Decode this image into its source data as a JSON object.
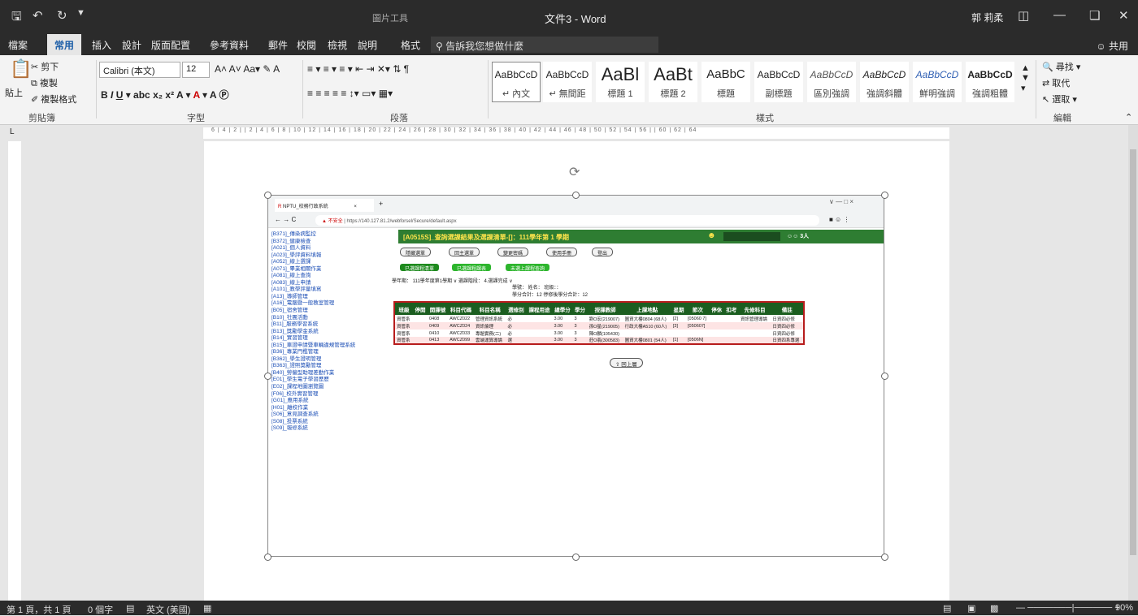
{
  "titlebar": {
    "save_icon": "save-icon",
    "undo_icon": "undo-icon",
    "redo_icon": "redo-icon",
    "context_tab": "圖片工具",
    "doc_title": "文件3 - Word",
    "user": "郭 莉柔"
  },
  "tabs": [
    "檔案",
    "常用",
    "插入",
    "設計",
    "版面配置",
    "參考資料",
    "郵件",
    "校閱",
    "檢視",
    "說明",
    "格式"
  ],
  "tell_me": "告訴我您想做什麼",
  "share": "共用",
  "clipboard": {
    "paste": "貼上",
    "cut": "剪下",
    "copy": "複製",
    "format_painter": "複製格式",
    "label": "剪貼簿"
  },
  "font": {
    "name": "Calibri (本文)",
    "size": "12",
    "label": "字型"
  },
  "paragraph": {
    "label": "段落"
  },
  "styles": {
    "label": "樣式",
    "items": [
      {
        "sample": "AaBbCcD",
        "name": "↵ 內文"
      },
      {
        "sample": "AaBbCcD",
        "name": "↵ 無間距"
      },
      {
        "sample": "AaBl",
        "name": "標題 1"
      },
      {
        "sample": "AaBt",
        "name": "標題 2"
      },
      {
        "sample": "AaBbC",
        "name": "標題"
      },
      {
        "sample": "AaBbCcD",
        "name": "副標題"
      },
      {
        "sample": "AaBbCcD",
        "name": "區別強調"
      },
      {
        "sample": "AaBbCcD",
        "name": "強調斜體"
      },
      {
        "sample": "AaBbCcD",
        "name": "鮮明強調"
      },
      {
        "sample": "AaBbCcD",
        "name": "強調粗體"
      }
    ]
  },
  "editing": {
    "find": "尋找",
    "replace": "取代",
    "select": "選取",
    "label": "編輯"
  },
  "ruler_text": "6 | 4 | 2 | | 2 | 4 | 6 | 8 | 10 | 12 | 14 | 16 | 18 | 20 | 22 | 24 | 26 | 28 | 30 | 32 | 34 | 36 | 38 | 40 | 42 | 44 | 46 | 48 | 50 | 52 | 54 | 56 | | 60 | 62 | 64",
  "status": {
    "page": "第 1 頁，共 1 頁",
    "words": "0 個字",
    "lang": "英文 (美國)",
    "zoom": "90%"
  },
  "screenshot": {
    "tab_title": "NPTU_校務行政系統",
    "url_warning": "不安全",
    "url": "https://140.127.81.2/webforsel/Secure/default.aspx",
    "nav": [
      "[B371]_傳染病監控",
      "[B372]_健康檢查",
      "[A021]_個人資料",
      "[A023]_學評資料填報",
      "[A052]_線上選課",
      "[A071]_畢業相關作業",
      "[A081]_線上查詢",
      "[A083]_線上申請",
      "[A101]_教學評量填寫",
      "[A13]_導師管理",
      "[A16]_電腦暨一般教室管理",
      "[B05]_宿舍管理",
      "[B10]_社團活動",
      "[B11]_服務學習系統",
      "[B13]_獎勵學金系統",
      "[B14]_實習管理",
      "[B15]_車證申請暨車輛違規管理系統",
      "[B36]_專業門檻管理",
      "[B362]_學生證明管理",
      "[B363]_證照獎勵管理",
      "[B40]_勞僱型助理差勤作業",
      "[E01]_學生電子學習歷歷",
      "[E02]_課程地圖瀏覽圖",
      "[F06]_校外實習管理",
      "[G01]_應用系統",
      "[H01]_離校作業",
      "[S06]_意見調查系統",
      "[S08]_投票系統",
      "[S09]_報修系統"
    ],
    "header": "[A0515S]_查詢選課結果及選課清單-[]：111學年第 1 學期",
    "header_count": "3人",
    "buttons": [
      "隱藏選單",
      "回主選單",
      "變更密碼",
      "使用手冊",
      "登出"
    ],
    "green_tabs": [
      "已選課程清單",
      "已選課程課表",
      "未選上課程查詢"
    ],
    "filter": "學年期： 111學年度第1學期 ∨  選課階段： 4.選課完成 ∨",
    "info1": "學號：          姓名：        班級：：",
    "info2": "學分合計：12    停修後學分合計：12",
    "table_headers": [
      "班級",
      "停開",
      "開課號",
      "科目代碼",
      "科目名稱",
      "選修別",
      "課程用途",
      "總學分",
      "學分",
      "授課教師",
      "上課地點",
      "星期",
      "節次",
      "停休",
      "扣考",
      "先修科目",
      "備註"
    ],
    "rows": [
      [
        "資管系",
        "",
        "0408",
        "AWCZ022",
        "管理資訊系統",
        "必",
        "",
        "3.00",
        "3",
        "劉O宏(219007)",
        "圖資大樓0804 (68人)",
        "[2]",
        "[05060 7]",
        "",
        "",
        "資訊管理導論",
        "日資四必修"
      ],
      [
        "資管系",
        "",
        "0409",
        "AWCZ024",
        "資訊倫理",
        "必",
        "",
        "3.00",
        "3",
        "孫O星(219005)",
        "行政大樓A510 (60人)",
        "[3]",
        "[050607]",
        "",
        "",
        "",
        "日資四必修"
      ],
      [
        "資管系",
        "",
        "0410",
        "AWCZ033",
        "專題實務(二)",
        "必",
        "",
        "3.00",
        "3",
        "陳O麟(105430)",
        "",
        "",
        "",
        "",
        "",
        "",
        "日資四必修"
      ],
      [
        "資管系",
        "",
        "0413",
        "AWCZ099",
        "雲端運算導論",
        "選",
        "",
        "3.00",
        "3",
        "莊O翡(300583)",
        "圖資大樓0801 (54人)",
        "[1]",
        "[0506N]",
        "",
        "",
        "",
        "日資四系專選"
      ]
    ],
    "back_button": "回上層"
  }
}
